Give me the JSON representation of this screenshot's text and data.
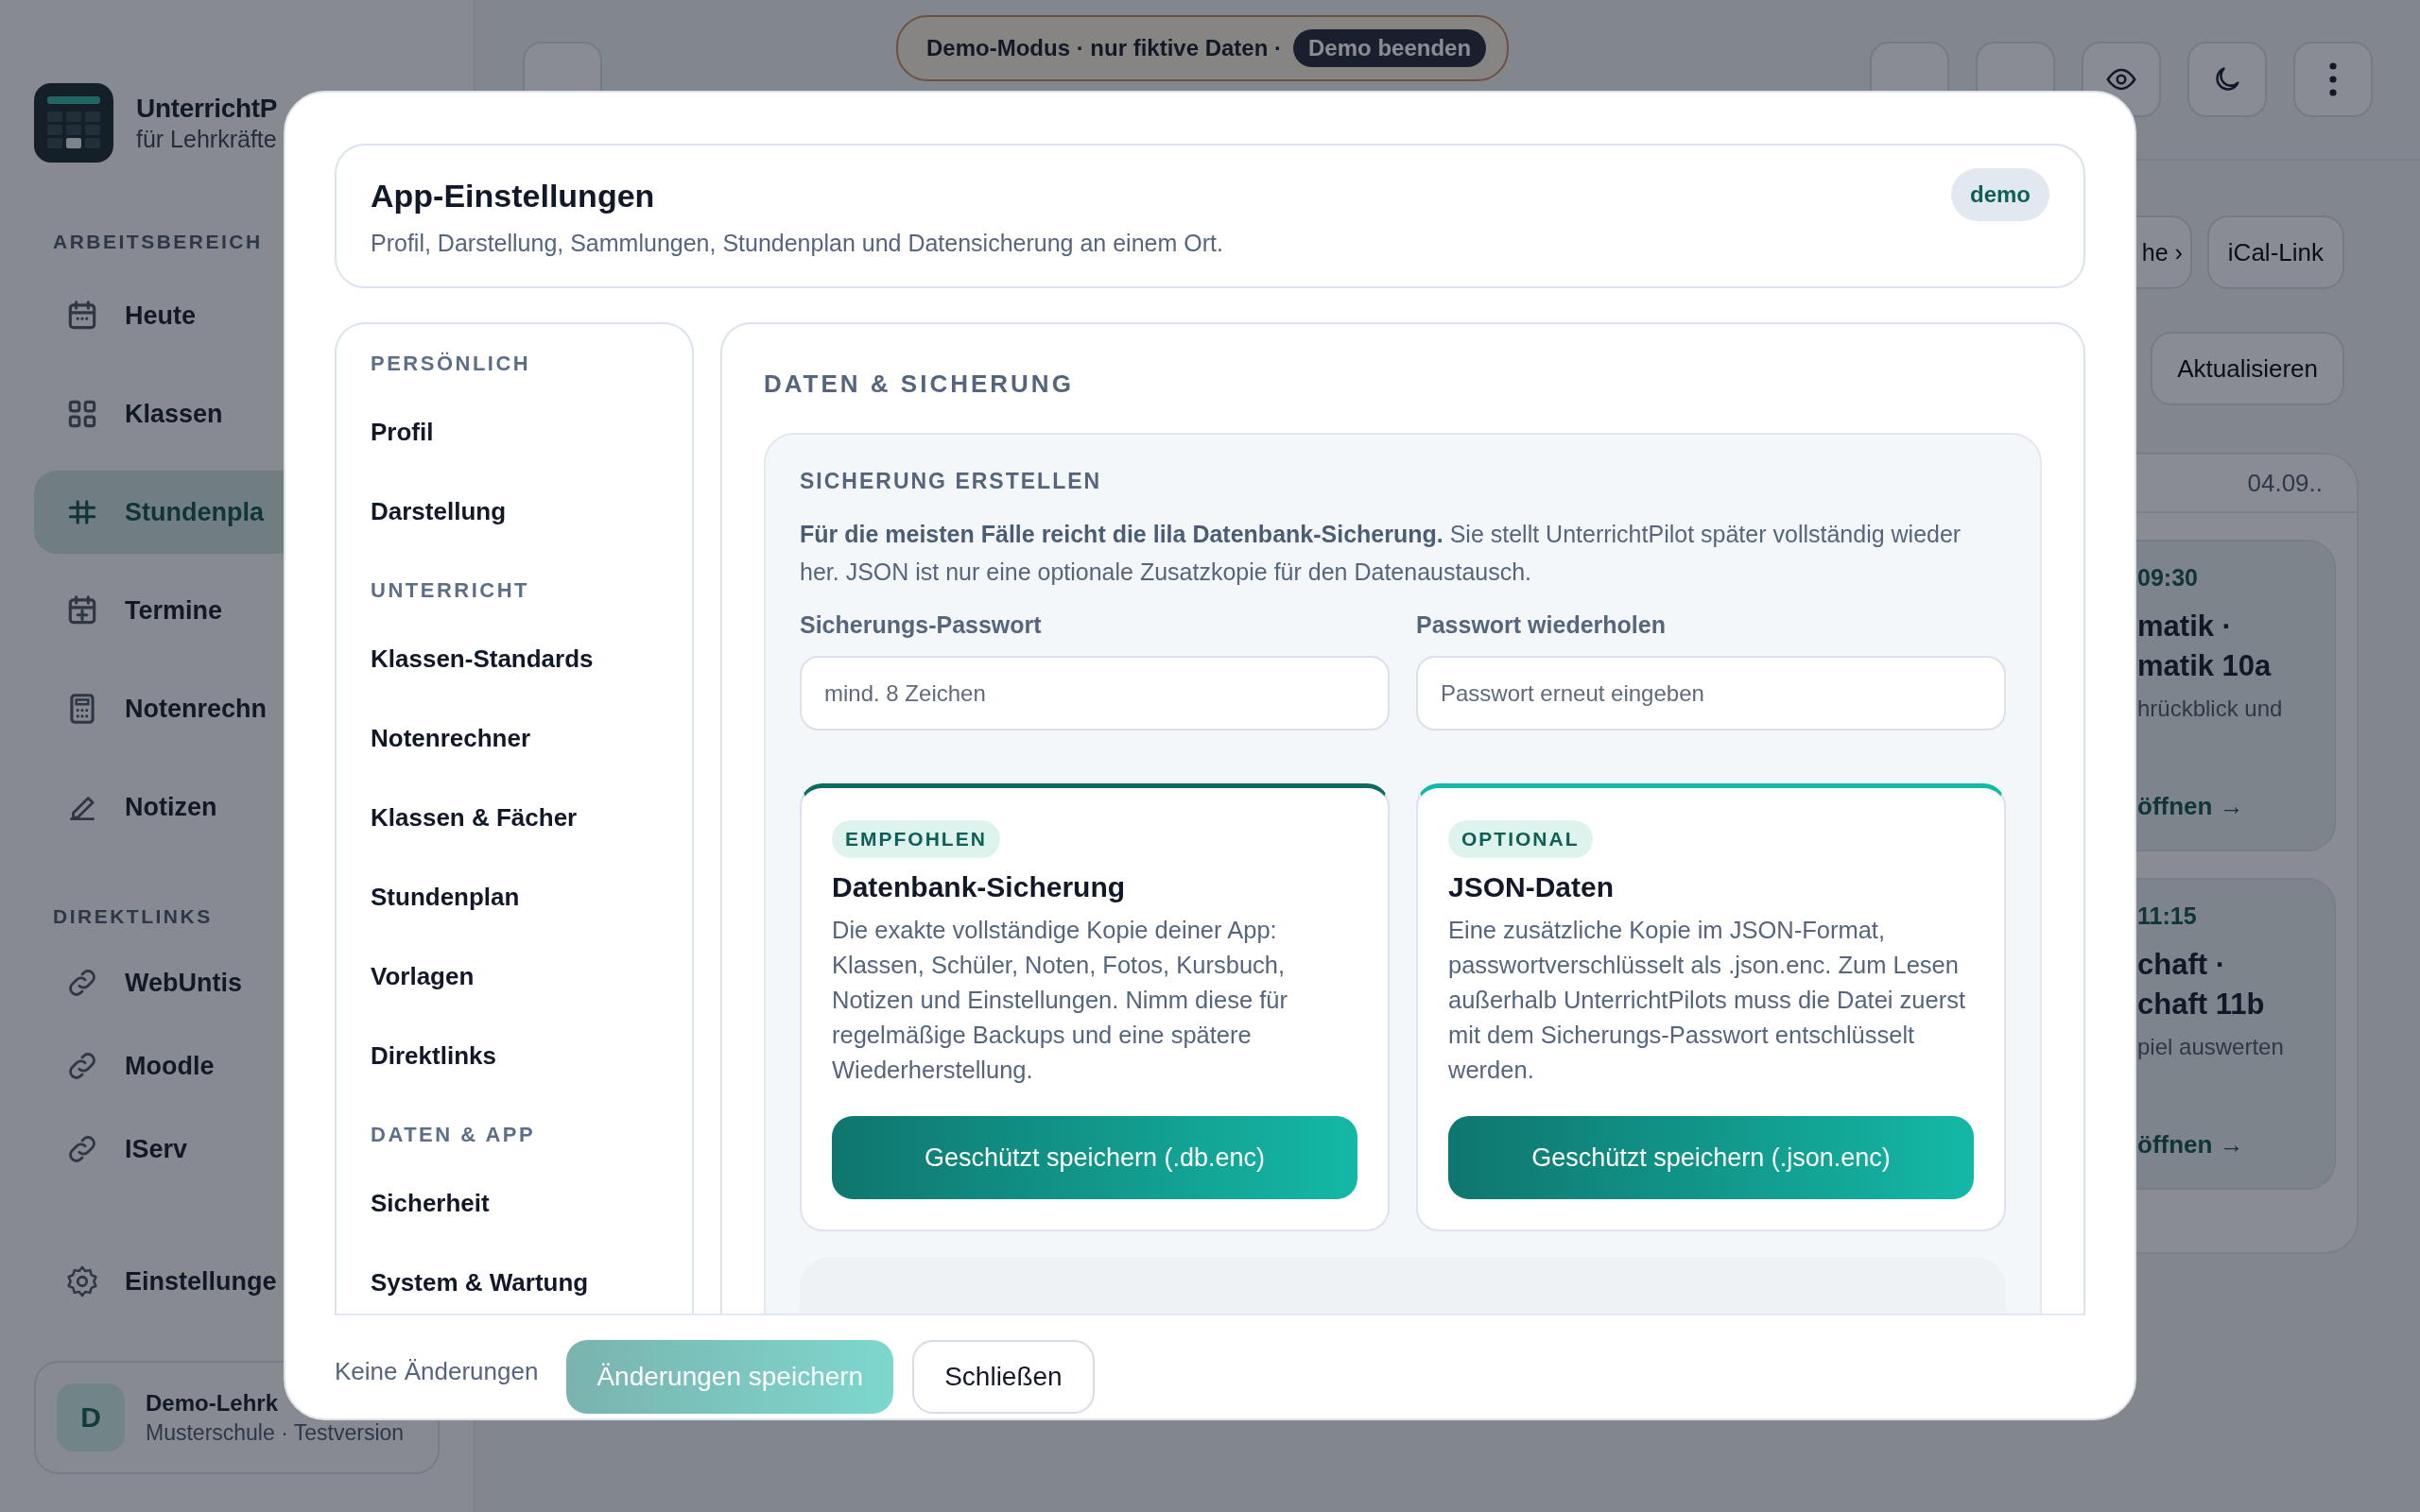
{
  "sidebar": {
    "app_name": "UnterrichtP",
    "tagline": "für Lehrkräfte",
    "sections": [
      {
        "title": "ARBEITSBEREICH",
        "items": [
          {
            "label": "Heute",
            "selected": false
          },
          {
            "label": "Klassen",
            "selected": false
          },
          {
            "label": "Stundenpla",
            "selected": true
          },
          {
            "label": "Termine",
            "selected": false
          },
          {
            "label": "Notenrechn",
            "selected": false
          },
          {
            "label": "Notizen",
            "selected": false
          }
        ]
      },
      {
        "title": "DIREKTLINKS",
        "items": [
          {
            "label": "WebUntis",
            "selected": false
          },
          {
            "label": "Moodle",
            "selected": false
          },
          {
            "label": "IServ",
            "selected": false
          }
        ]
      }
    ],
    "settings_item": "Einstellunge",
    "user": {
      "initial": "D",
      "name": "Demo-Lehrk",
      "detail": "Musterschule · Testversion"
    }
  },
  "demo_banner": {
    "text": "Demo-Modus · nur fiktive Daten ·",
    "button": "Demo beenden"
  },
  "schedule": {
    "buttons": [
      "he ›",
      "iCal-Link"
    ],
    "refresh_button": "Aktualisieren",
    "date": "04.09..",
    "lessons": [
      {
        "time": "09:30",
        "title_lines": [
          "matik ·",
          "matik 10a"
        ],
        "note": "hrückblick und",
        "link": "öffnen →"
      },
      {
        "time": "11:15",
        "title_lines": [
          "chaft ·",
          "chaft 11b"
        ],
        "note": "piel auswerten",
        "link": "öffnen →"
      }
    ]
  },
  "dialog": {
    "title": "App-Einstellungen",
    "subtitle": "Profil, Darstellung, Sammlungen, Stundenplan und Datensicherung an einem Ort.",
    "badge": "demo",
    "nav": [
      {
        "kind": "section",
        "label": "PERSÖNLICH"
      },
      {
        "kind": "item",
        "label": "Profil"
      },
      {
        "kind": "item",
        "label": "Darstellung"
      },
      {
        "kind": "section",
        "label": "UNTERRICHT"
      },
      {
        "kind": "item",
        "label": "Klassen-Standards"
      },
      {
        "kind": "item",
        "label": "Notenrechner"
      },
      {
        "kind": "item",
        "label": "Klassen & Fächer"
      },
      {
        "kind": "item",
        "label": "Stundenplan"
      },
      {
        "kind": "item",
        "label": "Vorlagen"
      },
      {
        "kind": "item",
        "label": "Direktlinks"
      },
      {
        "kind": "section",
        "label": "DATEN & APP"
      },
      {
        "kind": "item",
        "label": "Sicherheit"
      },
      {
        "kind": "item",
        "label": "System & Wartung"
      }
    ],
    "section_title": "DATEN & SICHERUNG",
    "backup": {
      "title": "SICHERUNG ERSTELLEN",
      "intro": "**Für die meisten Fälle reicht die lila Datenbank-Sicherung.** Sie stellt UnterrichtPilot später vollständig wieder her. JSON ist nur eine optionale Zusatzkopie für den Datenaustausch.",
      "fields": [
        {
          "label": "Sicherungs-Passwort",
          "placeholder": "mind. 8 Zeichen"
        },
        {
          "label": "Passwort wiederholen",
          "placeholder": "Passwort erneut eingeben"
        }
      ],
      "options": [
        {
          "tag": "EMPFOHLEN",
          "color": "#0f6b62",
          "title": "Datenbank-Sicherung",
          "description": "Die exakte vollständige Kopie deiner App: Klassen, Schüler, Noten, Fotos, Kursbuch, Notizen und Einstellungen. Nimm diese für regelmäßige Backups und eine spätere Wiederherstellung.",
          "button": "Geschützt speichern (.db.enc)"
        },
        {
          "tag": "OPTIONAL",
          "color": "#14b8a6",
          "title": "JSON-Daten",
          "description": "Eine zusätzliche Kopie im JSON-Format, passwortverschlüsselt als .json.enc. Zum Lesen außerhalb UnterrichtPilots muss die Datei zuerst mit dem Sicherungs-Passwort entschlüsselt werden.",
          "button": "Geschützt speichern (.json.enc)"
        }
      ]
    },
    "footer": {
      "status": "Keine Änderungen",
      "save_button": {
        "label": "Änderungen speichern",
        "disabled": true
      },
      "close_button": "Schließen"
    }
  }
}
